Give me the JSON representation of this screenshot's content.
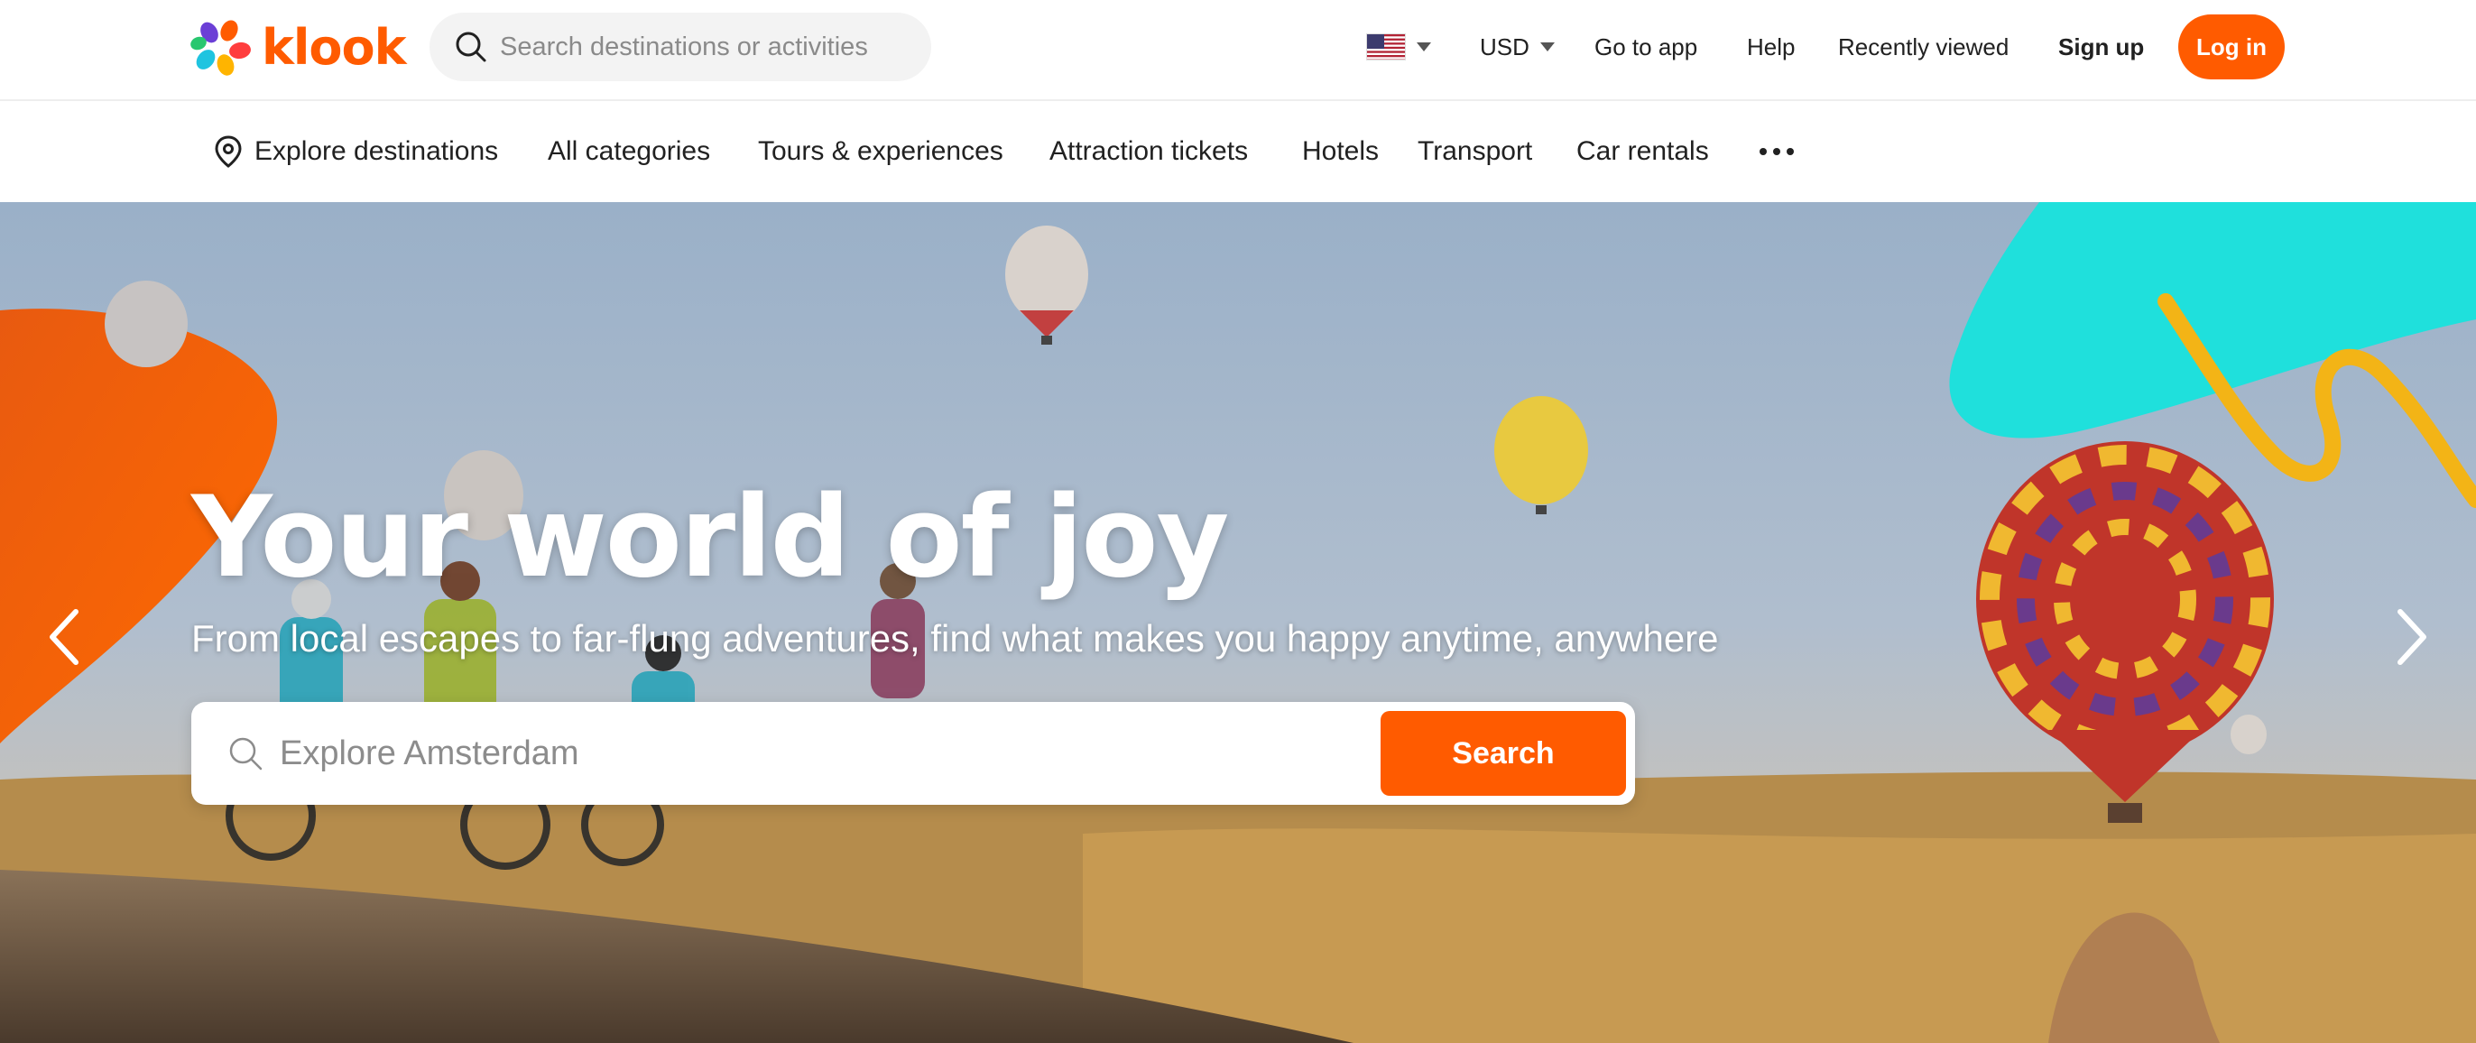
{
  "brand": {
    "name": "klook",
    "color": "#ff5b00"
  },
  "header": {
    "search_placeholder": "Search destinations or activities",
    "country_flag": "us-flag-icon",
    "currency": "USD",
    "go_to_app": "Go to app",
    "help": "Help",
    "recently_viewed": "Recently viewed",
    "sign_up": "Sign up",
    "log_in": "Log in"
  },
  "categories": [
    {
      "label": "Explore destinations",
      "icon": "location-pin-icon"
    },
    {
      "label": "All categories"
    },
    {
      "label": "Tours & experiences"
    },
    {
      "label": "Attraction tickets"
    },
    {
      "label": "Hotels"
    },
    {
      "label": "Transport"
    },
    {
      "label": "Car rentals"
    },
    {
      "label": "",
      "icon": "more-dots-icon"
    }
  ],
  "hero": {
    "title": "Your world of joy",
    "subtitle": "From local escapes to far-flung adventures, find what makes you happy anytime, anywhere",
    "search_placeholder": "Explore Amsterdam",
    "search_button": "Search",
    "prev_icon": "chevron-left-icon",
    "next_icon": "chevron-right-icon"
  },
  "colors": {
    "accent": "#ff5b00",
    "teal": "#1fe0dc",
    "yellow": "#f3b416"
  }
}
